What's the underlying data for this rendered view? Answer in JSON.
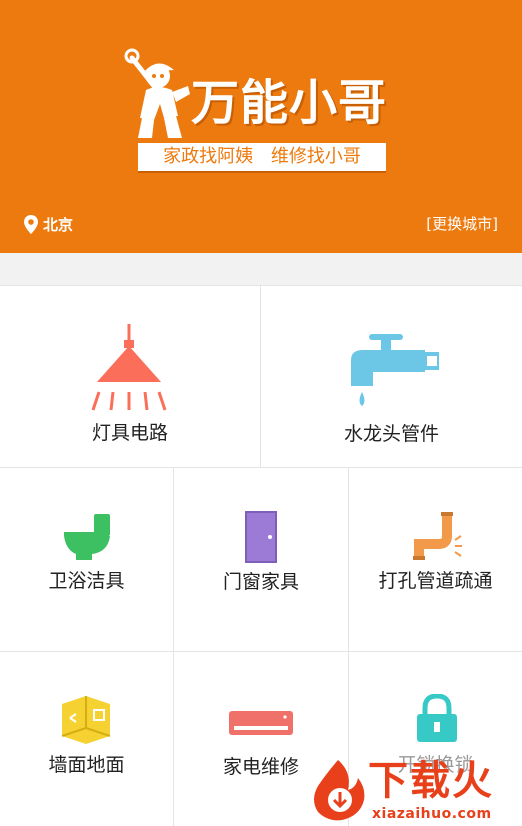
{
  "header": {
    "brand_name": "万能小哥",
    "slogan_left": "家政找阿姨",
    "slogan_right": "维修找小哥",
    "city": "北京",
    "change_city": "[更换城市]",
    "icons": {
      "location": "map-pin-icon",
      "logo": "handyman-mascot-icon"
    },
    "colors": {
      "header_bg": "#ED7A0E",
      "text": "#FFFFFF"
    }
  },
  "services": [
    {
      "label": "灯具电路",
      "icon": "lamp-icon",
      "color": "#FA6E5A"
    },
    {
      "label": "水龙头管件",
      "icon": "faucet-icon",
      "color": "#6CC6E6"
    },
    {
      "label": "卫浴洁具",
      "icon": "toilet-icon",
      "color": "#3CC062"
    },
    {
      "label": "门窗家具",
      "icon": "door-icon",
      "color": "#9B7BD6"
    },
    {
      "label": "打孔管道疏通",
      "icon": "pipe-icon",
      "color": "#F29A4A"
    },
    {
      "label": "墙面地面",
      "icon": "wall-floor-icon",
      "color": "#F5D232"
    },
    {
      "label": "家电维修",
      "icon": "air-conditioner-icon",
      "color": "#F0706A"
    },
    {
      "label": "开锁换锁",
      "icon": "lock-icon",
      "color": "#36C9C6"
    }
  ],
  "watermark": {
    "text": "下载火",
    "domain": "xiazaihuo.com",
    "color": "#E8401A"
  }
}
